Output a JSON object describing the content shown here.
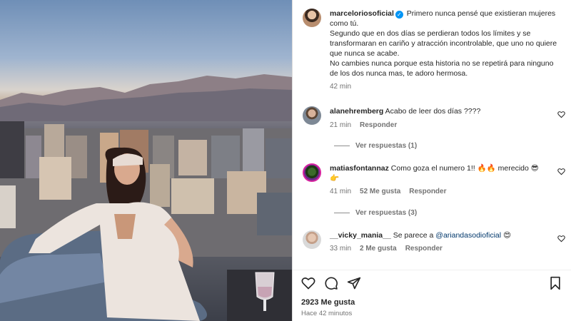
{
  "post": {
    "author": "marceloriosoficial",
    "caption": "Primero nunca pensé que existieran mujeres como tú.\nSegundo que en dos días se perdieran todos los límites y se transformaran en cariño y atracción incontrolable, que uno no quiere que nunca se acabe.\nNo cambies nunca porque esta historia no se repetirá para ninguno de los dos nunca mas, te adoro hermosa.",
    "time": "42 min"
  },
  "comments": [
    {
      "user": "alanehremberg",
      "text": "Acabo de leer dos días ????",
      "time": "21 min",
      "reply_label": "Responder",
      "view_replies": "Ver respuestas (1)"
    },
    {
      "user": "matiasfontannaz",
      "text": "Como goza el numero 1!! 🔥🔥 merecido 😎 👉",
      "time": "41 min",
      "likes": "52 Me gusta",
      "reply_label": "Responder",
      "view_replies": "Ver respuestas (3)"
    },
    {
      "user": "__vicky_mania__",
      "text_prefix": "Se parece a",
      "mention": "@ariandasodioficial",
      "text_suffix": "😍",
      "time": "33 min",
      "likes": "2 Me gusta",
      "reply_label": "Responder"
    }
  ],
  "footer": {
    "likes": "2923 Me gusta",
    "ago": "Hace 42 minutos"
  },
  "icons": {
    "like": "heart-icon",
    "comment": "comment-icon",
    "share": "send-icon",
    "save": "bookmark-icon",
    "verified": "verified-badge-icon"
  },
  "colors": {
    "verified": "#0095f6",
    "link": "#00376b",
    "muted": "#737373"
  }
}
